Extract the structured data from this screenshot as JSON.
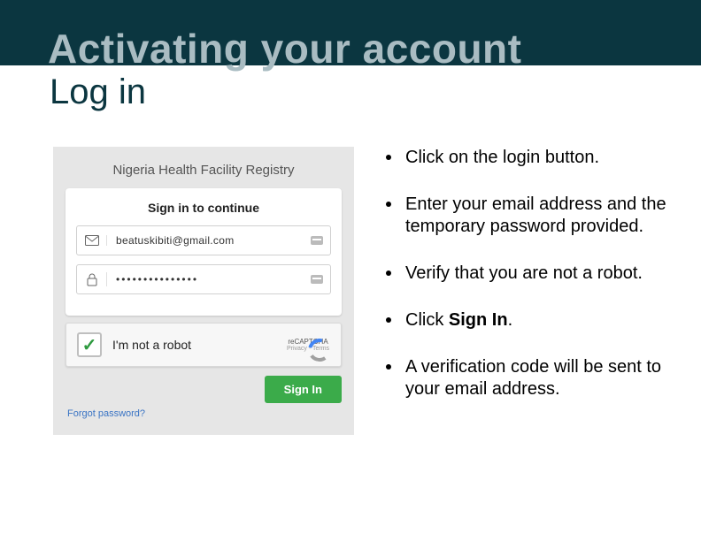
{
  "titles": {
    "main": "Activating your account",
    "sub": "Log in"
  },
  "login": {
    "app_name": "Nigeria Health Facility Registry",
    "panel_heading": "Sign in to continue",
    "email_value": "beatuskibiti@gmail.com",
    "password_display": "•••••••••••••••",
    "captcha_label": "I'm not a robot",
    "captcha_brand": "reCAPTCHA",
    "captcha_links": "Privacy - Terms",
    "signin_button": "Sign In",
    "forgot": "Forgot password?"
  },
  "steps": {
    "s1": "Click on the login button.",
    "s2": "Enter your email address and the temporary password provided.",
    "s3": "Verify that you are not a robot.",
    "s4_pre": "Click ",
    "s4_bold": "Sign In",
    "s4_post": ".",
    "s5": "A verification code will be sent to your email address."
  }
}
